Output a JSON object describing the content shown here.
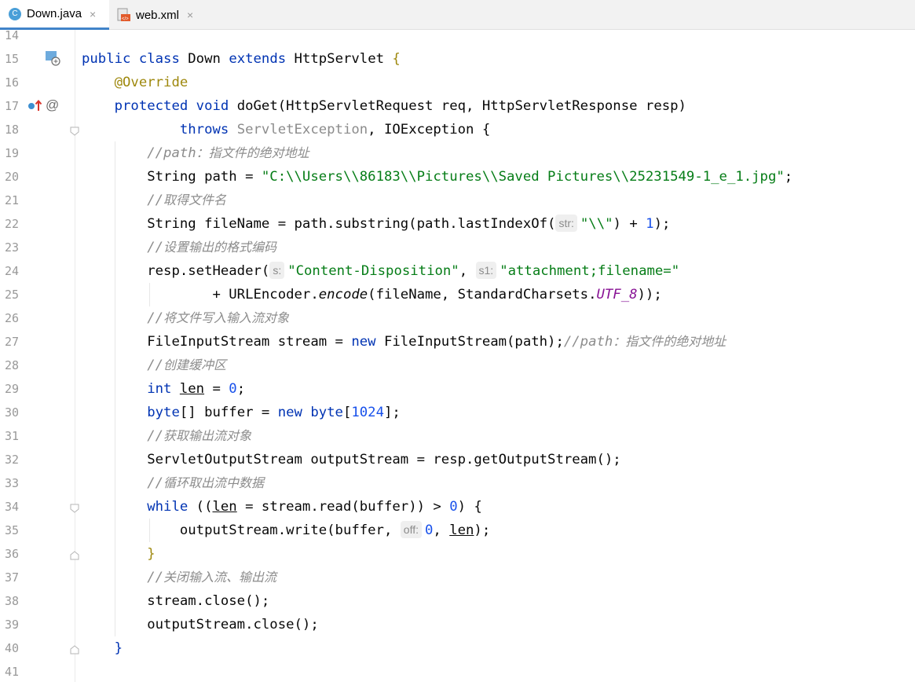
{
  "tabs": [
    {
      "label": "Down.java",
      "icon": "java-class-icon",
      "active": true
    },
    {
      "label": "web.xml",
      "icon": "xml-file-icon",
      "active": false
    }
  ],
  "tab_close_glyph": "×",
  "line_numbers": [
    "14",
    "15",
    "16",
    "17",
    "18",
    "19",
    "20",
    "21",
    "22",
    "23",
    "24",
    "25",
    "26",
    "27",
    "28",
    "29",
    "30",
    "31",
    "32",
    "33",
    "34",
    "35",
    "36",
    "37",
    "38",
    "39",
    "40",
    "41"
  ],
  "code": {
    "l15": {
      "public": "public",
      "class": "class",
      "name": " Down ",
      "extends": "extends",
      "super": " HttpServlet ",
      "brace": "{"
    },
    "l16": {
      "annotation": "@Override"
    },
    "l17": {
      "protected": "protected",
      "void": "void",
      "rest": " doGet(HttpServletRequest req, HttpServletResponse resp)"
    },
    "l18": {
      "throws": "throws",
      "ex1": "ServletException",
      "rest": ", IOException {"
    },
    "l19": {
      "comment_prefix": "//path",
      "comment_text": "：指文件的绝对地址"
    },
    "l20": {
      "decl": "String path = ",
      "literal": "\"C:\\\\Users\\\\86183\\\\Pictures\\\\Saved Pictures\\\\25231549-1_e_1.jpg\"",
      "end": ";"
    },
    "l21": {
      "comment_prefix": "//",
      "comment_text": "取得文件名"
    },
    "l22": {
      "decl": "String fileName = path.substring(path.lastIndexOf(",
      "hint": "str:",
      "literal": "\"\\\\\"",
      "mid": ") + ",
      "num": "1",
      "end": ");"
    },
    "l23": {
      "comment_prefix": "//",
      "comment_text": "设置输出的格式编码"
    },
    "l24": {
      "call": "resp.setHeader(",
      "hint1": "s:",
      "literal1": "\"Content-Disposition\"",
      "sep": ", ",
      "hint2": "s1:",
      "literal2": "\"attachment;filename=\""
    },
    "l25": {
      "pre": "+ URLEncoder.",
      "method": "encode",
      "args": "(fileName, StandardCharsets.",
      "const": "UTF_8",
      "end": "));"
    },
    "l26": {
      "comment_prefix": "//",
      "comment_text": "将文件写入输入流对象"
    },
    "l27": {
      "decl": "FileInputStream stream = ",
      "new": "new",
      "rest": " FileInputStream(path);",
      "comment_prefix": "//path",
      "comment_text": "：指文件的绝对地址"
    },
    "l28": {
      "comment_prefix": "//",
      "comment_text": "创建缓冲区"
    },
    "l29": {
      "int": "int",
      "var": "len",
      "mid": " = ",
      "num": "0",
      "end": ";"
    },
    "l30": {
      "byte": "byte",
      "mid": "[] buffer = ",
      "new": "new",
      "byte2": "byte",
      "open": "[",
      "num": "1024",
      "end": "];"
    },
    "l31": {
      "comment_prefix": "//",
      "comment_text": "获取输出流对象"
    },
    "l32": {
      "text": "ServletOutputStream outputStream = resp.getOutputStream();"
    },
    "l33": {
      "comment_prefix": "//",
      "comment_text": "循环取出流中数据"
    },
    "l34": {
      "while": "while",
      "pre": " ((",
      "var": "len",
      "mid": " = stream.read(buffer)) > ",
      "num": "0",
      "end": ") {"
    },
    "l35": {
      "call": "outputStream.write(buffer, ",
      "hint": "off:",
      "num": "0",
      "sep": ", ",
      "var": "len",
      "end": ");"
    },
    "l36": {
      "brace": "}"
    },
    "l37": {
      "comment_prefix": "//",
      "comment_text": "关闭输入流、输出流"
    },
    "l38": {
      "text": "stream.close();"
    },
    "l39": {
      "text": "outputStream.close();"
    },
    "l40": {
      "brace": "}"
    }
  },
  "colors": {
    "keyword": "#0033b3",
    "string": "#067d17",
    "number": "#1750eb",
    "comment": "#8c8c8c",
    "annotation": "#9e880d",
    "static": "#871094",
    "tab_accent": "#4083c9"
  }
}
